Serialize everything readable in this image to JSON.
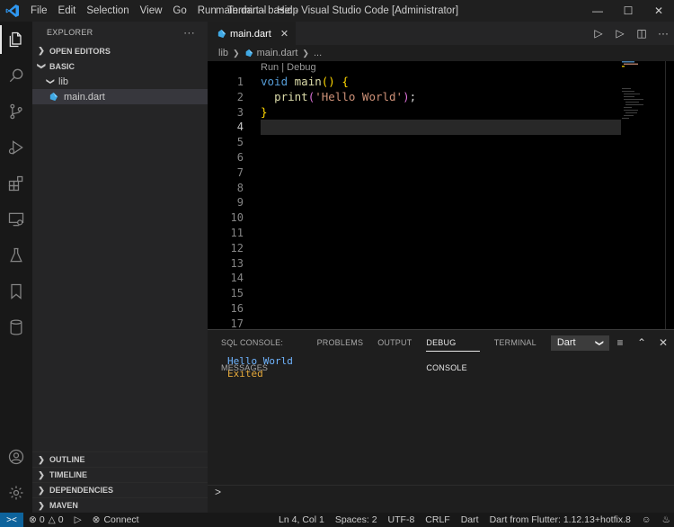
{
  "titlebar": {
    "menu": [
      "File",
      "Edit",
      "Selection",
      "View",
      "Go",
      "Run",
      "Terminal",
      "Help"
    ],
    "title": "main.dart - basic - Visual Studio Code [Administrator]"
  },
  "sidebar": {
    "title": "EXPLORER",
    "more": "···",
    "open_editors": "OPEN EDITORS",
    "workspace": "BASIC",
    "folder": "lib",
    "file": "main.dart",
    "bottom_sections": [
      "OUTLINE",
      "TIMELINE",
      "DEPENDENCIES",
      "MAVEN"
    ]
  },
  "tabs": [
    {
      "label": "main.dart",
      "close": "✕"
    }
  ],
  "breadcrumb": {
    "parts": [
      "lib",
      "main.dart",
      "..."
    ]
  },
  "editor": {
    "codelens": "Run | Debug",
    "line_numbers": [
      "1",
      "2",
      "3",
      "4",
      "5",
      "6",
      "7",
      "8",
      "9",
      "10",
      "11",
      "12",
      "13",
      "14",
      "15",
      "16",
      "17"
    ],
    "current_line": 4,
    "code": {
      "l1_kw": "void",
      "l1_fn": "main",
      "l1_paren": "()",
      "l1_brace": "{",
      "l2_fn": "print",
      "l2_open": "(",
      "l2_str": "'Hello World'",
      "l2_close": ")",
      "l2_semi": ";",
      "l3_brace": "}"
    }
  },
  "panel": {
    "tabs": [
      "SQL CONSOLE: MESSAGES",
      "PROBLEMS",
      "OUTPUT",
      "DEBUG CONSOLE",
      "TERMINAL"
    ],
    "active_tab": "DEBUG CONSOLE",
    "select_value": "Dart",
    "console_lines": [
      {
        "text": "Hello World",
        "color": "#6fb4ff"
      },
      {
        "text": "Exited",
        "color": "#e5a93b"
      }
    ],
    "repl_prompt": ">"
  },
  "statusbar": {
    "remote": "><",
    "errors": "0",
    "warnings": "0",
    "connect": "Connect",
    "position": "Ln 4, Col 1",
    "spaces": "Spaces: 2",
    "encoding": "UTF-8",
    "eol": "CRLF",
    "language": "Dart",
    "sdk": "Dart from Flutter: 1.12.13+hotfix.8"
  },
  "colors": {
    "accent": "#0e639c",
    "dart_icon": "#40a9e4"
  }
}
